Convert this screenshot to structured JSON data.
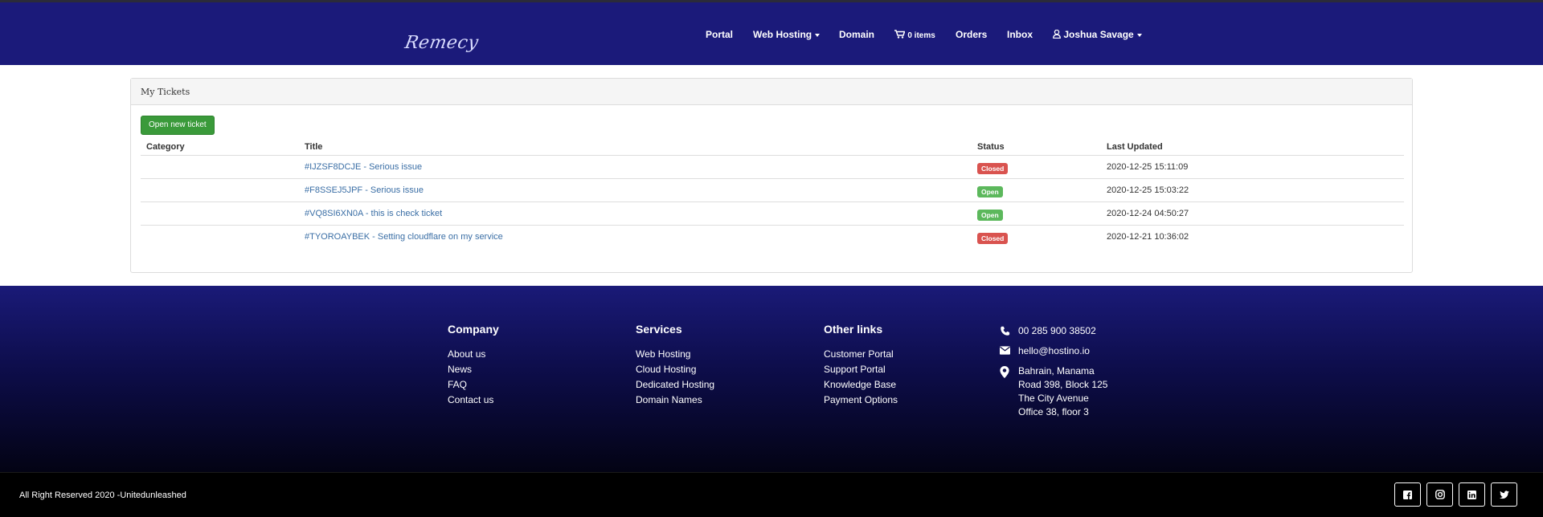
{
  "brand": {
    "logo_text": "Remecy"
  },
  "nav": {
    "portal": "Portal",
    "web_hosting": "Web Hosting",
    "domain": "Domain",
    "cart_count": "0 items",
    "orders": "Orders",
    "inbox": "Inbox",
    "user": "Joshua Savage"
  },
  "panel": {
    "title": "My Tickets",
    "new_ticket_label": "Open new ticket",
    "columns": {
      "category": "Category",
      "title": "Title",
      "status": "Status",
      "updated": "Last Updated"
    },
    "tickets": [
      {
        "category": "",
        "title": "#IJZSF8DCJE - Serious issue",
        "status": "Closed",
        "updated": "2020-12-25 15:11:09"
      },
      {
        "category": "",
        "title": "#F8SSEJ5JPF - Serious issue",
        "status": "Open",
        "updated": "2020-12-25 15:03:22"
      },
      {
        "category": "",
        "title": "#VQ8SI6XN0A - this is check ticket",
        "status": "Open",
        "updated": "2020-12-24 04:50:27"
      },
      {
        "category": "",
        "title": "#TYOROAYBEK - Setting cloudflare on my service",
        "status": "Closed",
        "updated": "2020-12-21 10:36:02"
      }
    ],
    "status_colors": {
      "Closed": "#d9534f",
      "Open": "#5cb85c"
    }
  },
  "footer": {
    "company": {
      "heading": "Company",
      "links": [
        "About us",
        "News",
        "FAQ",
        "Contact us"
      ]
    },
    "services": {
      "heading": "Services",
      "links": [
        "Web Hosting",
        "Cloud Hosting",
        "Dedicated Hosting",
        "Domain Names"
      ]
    },
    "other": {
      "heading": "Other links",
      "links": [
        "Customer Portal",
        "Support Portal",
        "Knowledge Base",
        "Payment Options"
      ]
    },
    "contact": {
      "phone": "00 285 900 38502",
      "email": "hello@hostino.io",
      "address": [
        "Bahrain, Manama",
        "Road 398, Block 125",
        "The City Avenue",
        "Office 38, floor 3"
      ]
    },
    "copyright": "All Right Reserved 2020 -Unitedunleashed",
    "social": [
      "facebook-icon",
      "instagram-icon",
      "linkedin-icon",
      "twitter-icon"
    ]
  },
  "colors": {
    "nav_bg": "#1b1a7a",
    "footer_top": "#1a1a78",
    "footer_bottom": "#030314",
    "link": "#3a6ea5",
    "button_green": "#3a9a3a"
  }
}
